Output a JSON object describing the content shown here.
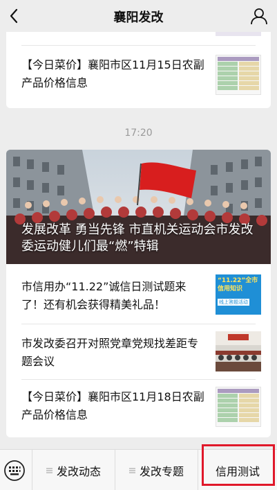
{
  "header": {
    "title": "襄阳发改"
  },
  "feed": {
    "article_1": {
      "headline": "【今日菜价】襄阳市区11月15日农副产品价格信息",
      "thumb_icon": "price-table-thumbnail"
    },
    "time_label": "17:20",
    "cover": {
      "caption": "发展改革 勇当先锋 市直机关运动会市发改委运动健儿们最“燃”特辑",
      "thumb_icon": "group-photo-with-red-flag"
    },
    "article_2": {
      "headline": "市信用办“11.22”诚信日测试题来了！还有机会获得精美礼品！",
      "thumb_text": "“11.22”全市信用知识",
      "thumb_subtext": "线上答题活动"
    },
    "article_3": {
      "headline": "市发改委召开对照党章党规找差距专题会议",
      "thumb_icon": "meeting-room-photo"
    },
    "article_4": {
      "headline": "【今日菜价】襄阳市区11月18日农副产品价格信息",
      "thumb_icon": "price-table-thumbnail"
    }
  },
  "tabbar": {
    "tabs": [
      {
        "label": "发改动态"
      },
      {
        "label": "发改专题"
      },
      {
        "label": "信用测试"
      }
    ]
  },
  "colors": {
    "background": "#ededed",
    "card": "#ffffff",
    "highlight": "#e0182a",
    "flag_red": "#d81e1e"
  }
}
